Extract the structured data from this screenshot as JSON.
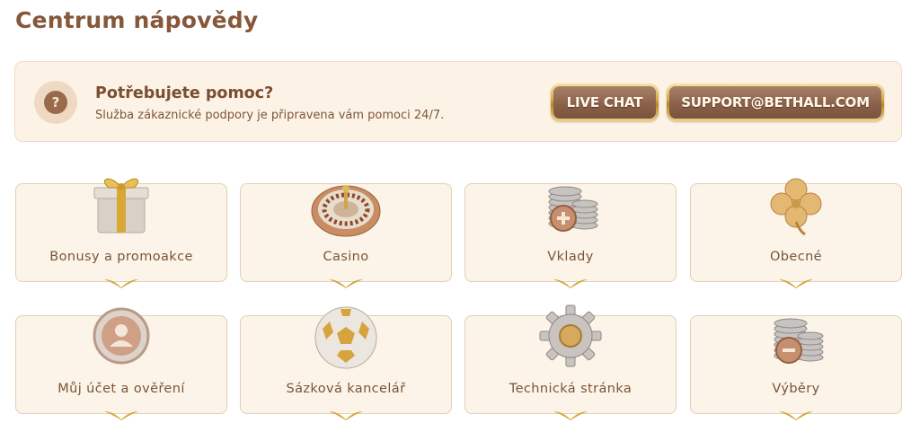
{
  "page": {
    "title": "Centrum nápovědy"
  },
  "help": {
    "title": "Potřebujete pomoc?",
    "subtitle": "Služba zákaznické podpory je připravena vám pomoci 24/7.",
    "icon": "question-icon",
    "icon_glyph": "?",
    "buttons": {
      "live_chat": "LIVE CHAT",
      "support_email": "SUPPORT@BETHALL.COM"
    }
  },
  "categories": [
    {
      "label": "Bonusy a promoakce",
      "icon": "gift-icon"
    },
    {
      "label": "Casino",
      "icon": "roulette-icon"
    },
    {
      "label": "Vklady",
      "icon": "coins-plus-icon"
    },
    {
      "label": "Obecné",
      "icon": "clover-icon"
    },
    {
      "label": "Můj účet a ověření",
      "icon": "user-icon"
    },
    {
      "label": "Sázková kancelář",
      "icon": "soccer-ball-icon"
    },
    {
      "label": "Technická stránka",
      "icon": "gear-icon"
    },
    {
      "label": "Výběry",
      "icon": "coins-minus-icon"
    }
  ],
  "colors": {
    "accent_brown": "#86573a",
    "banner_bg": "#fcf3e6",
    "card_bg": "#fcf4e8",
    "gold": "#d3a546"
  }
}
